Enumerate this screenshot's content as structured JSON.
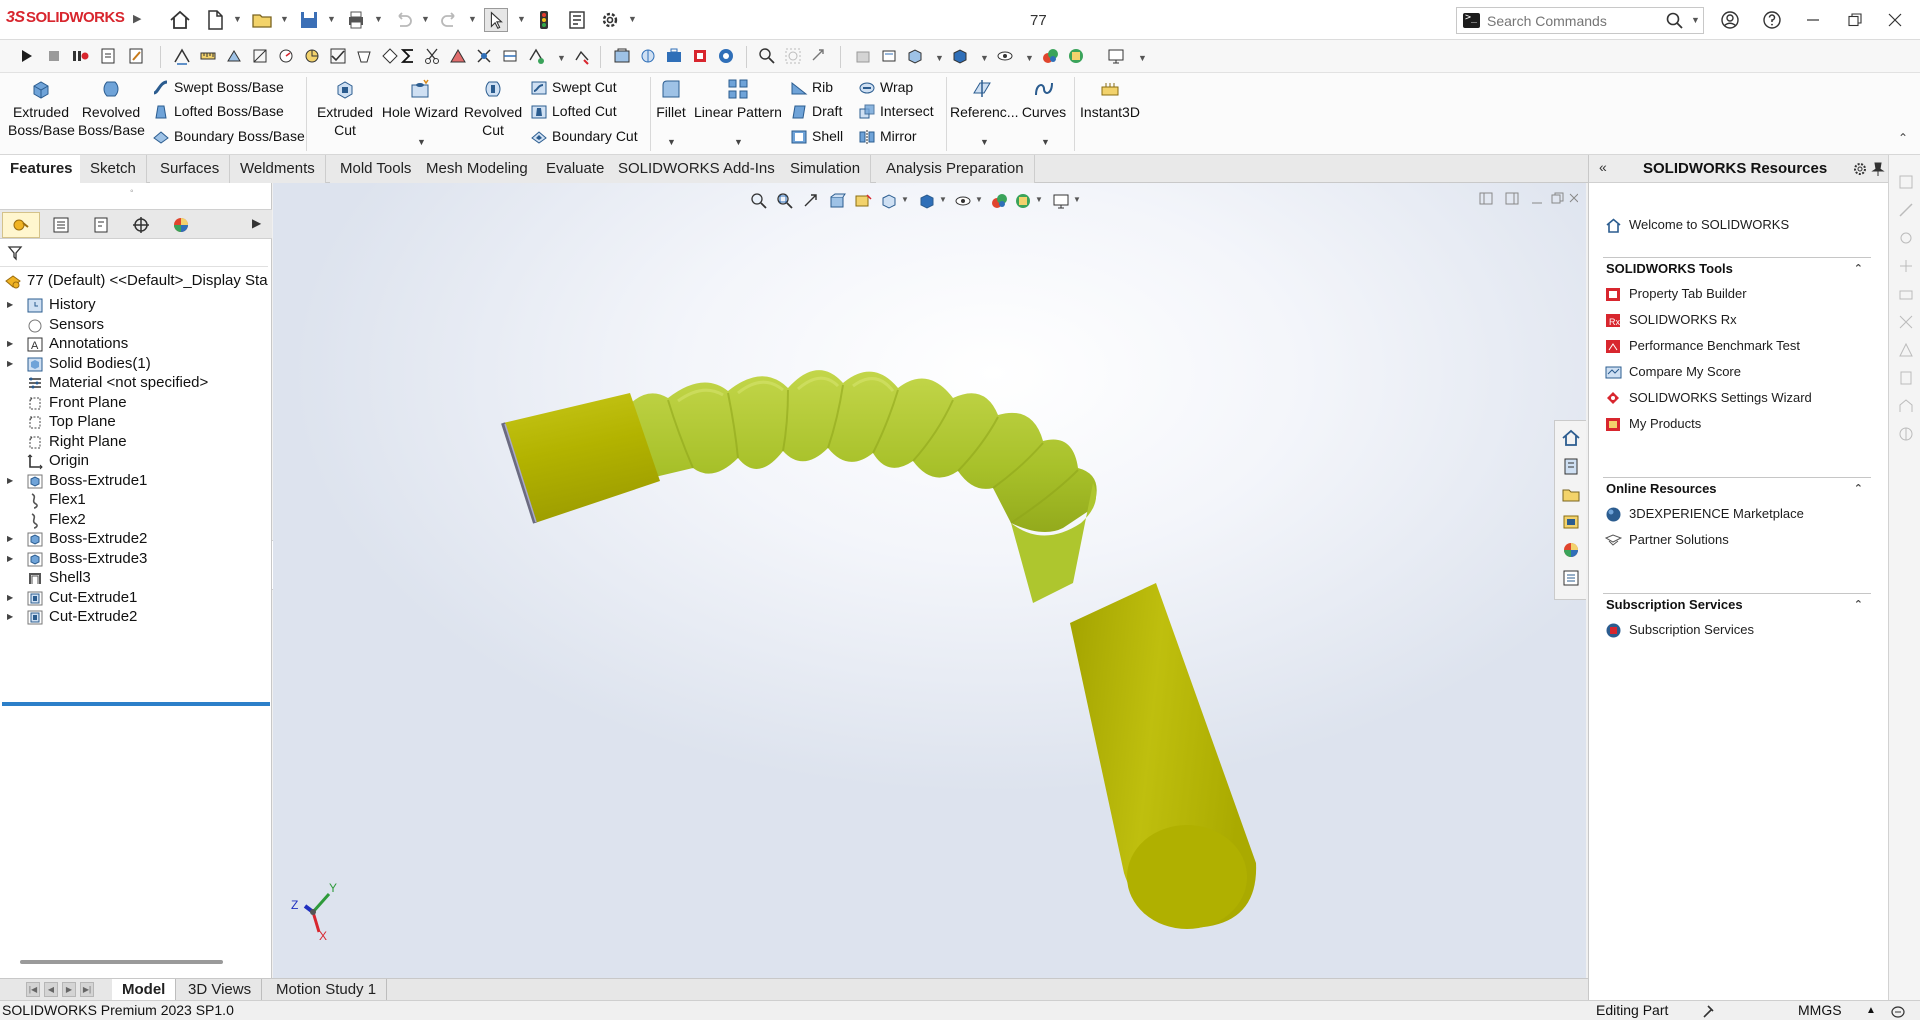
{
  "app": {
    "brand_prefix": "3S",
    "brand": "SOLIDWORKS",
    "document_title": "77"
  },
  "search": {
    "placeholder": "Search Commands"
  },
  "ribbon": {
    "extruded_boss": "Extruded Boss/Base",
    "revolved_boss": "Revolved Boss/Base",
    "swept_boss": "Swept Boss/Base",
    "lofted_boss": "Lofted Boss/Base",
    "boundary_boss": "Boundary Boss/Base",
    "extruded_cut": "Extruded Cut",
    "hole_wizard": "Hole Wizard",
    "revolved_cut": "Revolved Cut",
    "swept_cut": "Swept Cut",
    "lofted_cut": "Lofted Cut",
    "boundary_cut": "Boundary Cut",
    "fillet": "Fillet",
    "linear_pattern": "Linear Pattern",
    "rib": "Rib",
    "draft": "Draft",
    "shell": "Shell",
    "wrap": "Wrap",
    "intersect": "Intersect",
    "mirror": "Mirror",
    "reference": "Referenc...",
    "curves": "Curves",
    "instant3d": "Instant3D"
  },
  "tabs": [
    {
      "label": "Features",
      "active": true
    },
    {
      "label": "Sketch"
    },
    {
      "label": "Surfaces"
    },
    {
      "label": "Weldments"
    },
    {
      "label": "Mold Tools"
    },
    {
      "label": "Mesh Modeling"
    },
    {
      "label": "Evaluate"
    },
    {
      "label": "SOLIDWORKS Add-Ins"
    },
    {
      "label": "Simulation"
    },
    {
      "label": "Analysis Preparation"
    }
  ],
  "tree": {
    "root": "77 (Default) <<Default>_Display Sta",
    "items": [
      {
        "label": "History",
        "icon": "history-icon",
        "expandable": true
      },
      {
        "label": "Sensors",
        "icon": "sensor-icon",
        "expandable": false
      },
      {
        "label": "Annotations",
        "icon": "annotations-icon",
        "expandable": true
      },
      {
        "label": "Solid Bodies(1)",
        "icon": "solid-bodies-icon",
        "expandable": true
      },
      {
        "label": "Material <not specified>",
        "icon": "material-icon",
        "expandable": false
      },
      {
        "label": "Front Plane",
        "icon": "plane-icon",
        "expandable": false
      },
      {
        "label": "Top Plane",
        "icon": "plane-icon",
        "expandable": false
      },
      {
        "label": "Right Plane",
        "icon": "plane-icon",
        "expandable": false
      },
      {
        "label": "Origin",
        "icon": "origin-icon",
        "expandable": false
      },
      {
        "label": "Boss-Extrude1",
        "icon": "extrude-icon",
        "expandable": true
      },
      {
        "label": "Flex1",
        "icon": "flex-icon",
        "expandable": false
      },
      {
        "label": "Flex2",
        "icon": "flex-icon",
        "expandable": false
      },
      {
        "label": "Boss-Extrude2",
        "icon": "extrude-icon",
        "expandable": true
      },
      {
        "label": "Boss-Extrude3",
        "icon": "extrude-icon",
        "expandable": true
      },
      {
        "label": "Shell3",
        "icon": "shell-icon",
        "expandable": false
      },
      {
        "label": "Cut-Extrude1",
        "icon": "cut-extrude-icon",
        "expandable": true
      },
      {
        "label": "Cut-Extrude2",
        "icon": "cut-extrude-icon",
        "expandable": true
      }
    ]
  },
  "bottom_tabs": [
    {
      "label": "Model",
      "active": true
    },
    {
      "label": "3D Views"
    },
    {
      "label": "Motion Study 1"
    }
  ],
  "status": {
    "product": "SOLIDWORKS Premium 2023 SP1.0",
    "mode": "Editing Part",
    "units": "MMGS"
  },
  "task_pane": {
    "title": "SOLIDWORKS Resources",
    "welcome": "Welcome to SOLIDWORKS",
    "sections": [
      {
        "title": "SOLIDWORKS Tools",
        "items": [
          "Property Tab Builder",
          "SOLIDWORKS Rx",
          "Performance Benchmark Test",
          "Compare My Score",
          "SOLIDWORKS Settings Wizard",
          "My Products"
        ]
      },
      {
        "title": "Online Resources",
        "items": [
          "3DEXPERIENCE Marketplace",
          "Partner Solutions"
        ]
      },
      {
        "title": "Subscription Services",
        "items": [
          "Subscription Services"
        ]
      }
    ]
  },
  "triad": {
    "x": "X",
    "y": "Y",
    "z": "Z"
  },
  "colors": {
    "model": "#b8b800",
    "model_flex": "#a9c22a",
    "brand_red": "#d8262e",
    "accent_blue": "#2c7fc9"
  }
}
